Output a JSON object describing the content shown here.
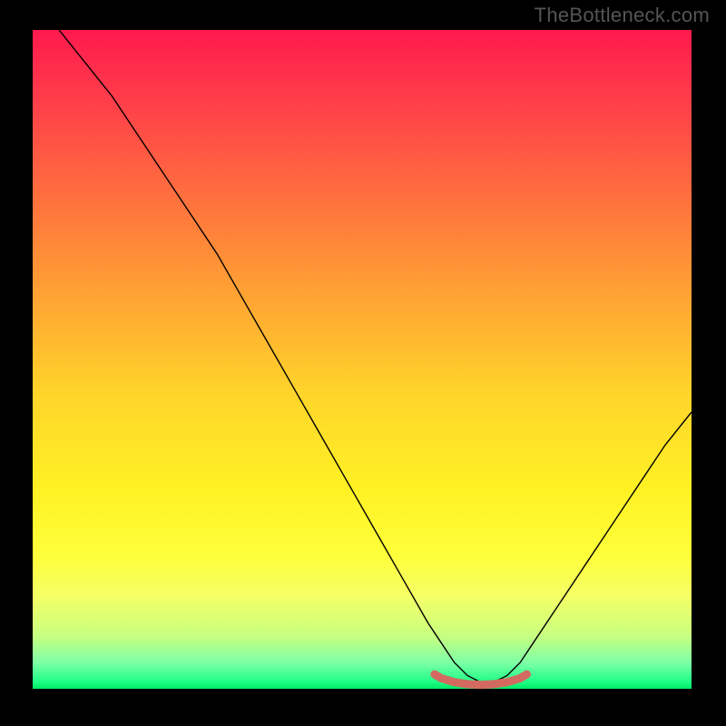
{
  "watermark": "TheBottleneck.com",
  "chart_data": {
    "type": "line",
    "title": "",
    "xlabel": "",
    "ylabel": "",
    "xlim": [
      0,
      100
    ],
    "ylim": [
      0,
      100
    ],
    "series": [
      {
        "name": "bottleneck-curve",
        "x": [
          0,
          4,
          8,
          12,
          16,
          20,
          24,
          28,
          32,
          36,
          40,
          44,
          48,
          52,
          56,
          60,
          62,
          64,
          66,
          68,
          70,
          72,
          74,
          76,
          80,
          84,
          88,
          92,
          96,
          100
        ],
        "values": [
          105,
          100,
          95,
          90,
          84,
          78,
          72,
          66,
          59,
          52,
          45,
          38,
          31,
          24,
          17,
          10,
          7,
          4,
          2,
          1,
          1,
          2,
          4,
          7,
          13,
          19,
          25,
          31,
          37,
          42
        ]
      },
      {
        "name": "optimal-marker",
        "x": [
          61,
          62,
          64,
          66,
          68,
          70,
          72,
          74,
          75
        ],
        "values": [
          2.2,
          1.6,
          1.0,
          0.7,
          0.6,
          0.7,
          1.0,
          1.6,
          2.2
        ]
      }
    ],
    "colors": {
      "curve": "#000000",
      "marker": "#d46a5f",
      "gradient_top": "#ff1a4d",
      "gradient_bottom": "#00e865"
    }
  }
}
